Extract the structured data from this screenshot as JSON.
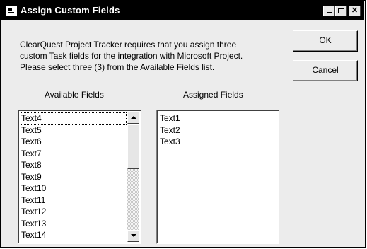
{
  "window": {
    "title": "Assign Custom Fields",
    "colors": {
      "titlebar": "#000000",
      "face": "#ececec",
      "list_bg": "#ffffff"
    }
  },
  "message": {
    "line1": "ClearQuest Project Tracker requires that you assign three",
    "line2": "custom Task fields for the integration with Microsoft Project.",
    "line3": "Please select three (3) from the Available Fields list."
  },
  "buttons": {
    "ok": "OK",
    "cancel": "Cancel"
  },
  "available": {
    "label": "Available Fields",
    "items": [
      "Text4",
      "Text5",
      "Text6",
      "Text7",
      "Text8",
      "Text9",
      "Text10",
      "Text11",
      "Text12",
      "Text13",
      "Text14"
    ]
  },
  "assigned": {
    "label": "Assigned Fields",
    "items": [
      "Text1",
      "Text2",
      "Text3"
    ]
  },
  "icons": {
    "app": "app-window-icon",
    "minimize": "minimize-icon",
    "maximize": "maximize-icon",
    "close": "close-icon",
    "scroll_up": "arrow-up-icon",
    "scroll_down": "arrow-down-icon"
  }
}
